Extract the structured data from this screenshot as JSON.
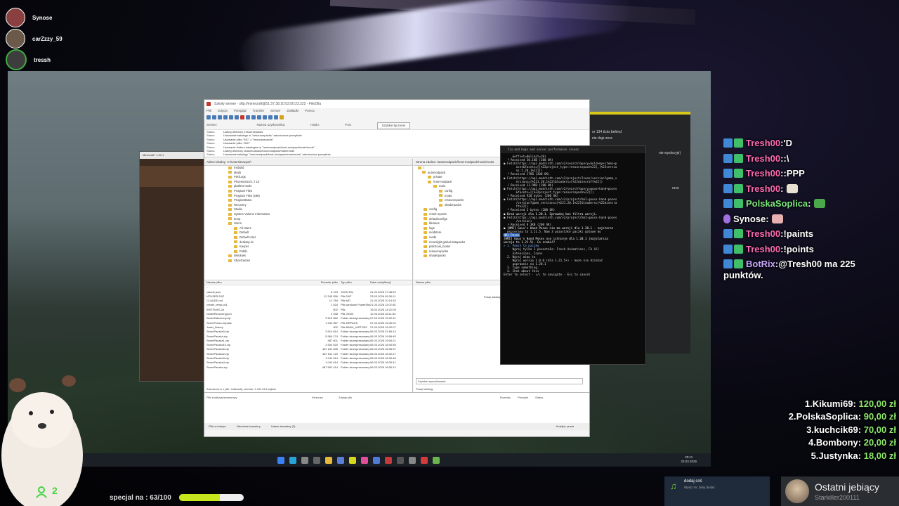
{
  "viewers": [
    "Synose",
    "carZzzy_59",
    "tressh"
  ],
  "minecraft": {
    "title": "Minecraft* 1.20.1"
  },
  "dark_panel": {
    "line1": "or 134 ticks behind",
    "line2": "nie daje zesc",
    "line3": "nie wyslocyje)",
    "line4": "urce"
  },
  "filezilla": {
    "title": "Szkoły serwer - sftp://minecraft@51.57.38.10:53:50:23.222 - FileZilla",
    "menu": [
      "Plik",
      "Edycja",
      "Przegląd",
      "Transfer",
      "Serwer",
      "Zakładki",
      "Pomoc"
    ],
    "quickconnect": {
      "server_label": "Serwer:",
      "user_label": "Nazwa użytkownika:",
      "pass_label": "Hasło:",
      "port_label": "Port:",
      "button": "Szybkie łączenie"
    },
    "log": [
      {
        "k": "Status:",
        "v": "Listing directory /resourcepacks"
      },
      {
        "k": "Status:",
        "v": "Listowanie katalogu w \"/resourcepacks\" zakończone pomyślnie"
      },
      {
        "k": "Status:",
        "v": "Usuwanie pliku \"MC\" z \"/resourcepacks\""
      },
      {
        "k": "Status:",
        "v": "Usuwanie pliku \"/MC\""
      },
      {
        "k": "Status:",
        "v": "Usuwanie folderu katalogów w \"/automodpack/host-modpack/main/mods\""
      },
      {
        "k": "Status:",
        "v": "Listing directory /automodpack/host-modpack/main/mods"
      },
      {
        "k": "Status:",
        "v": "Listowanie katalogu \"/automodpack/host-modpack/main/mods\" zakończone pomyślnie"
      }
    ],
    "local_addr": {
      "label": "Adres lokalny:",
      "value": "C:\\Users\\Kacper\\"
    },
    "remote_addr": {
      "label": "Strona zdalna:",
      "value": "/automodpack/host-modpack/main/mods"
    },
    "local_tree": [
      "msbuild",
      "Mods",
      "PerfLogs",
      "PhoenixSoul 1.7.10",
      "platform-tools",
      "Program Files",
      "Program Files (x86)",
      "ProgramData",
      "Recovery",
      "Studio",
      "System Volume Information",
      "temp",
      "Users",
      "All Users",
      "Default",
      "Default User",
      "desktop.ini",
      "Kacper",
      "Public",
      "Windows",
      "XboxGames"
    ],
    "remote_tree": [
      "/",
      "automodpack",
      "private",
      "host-modpack",
      "main",
      "config",
      "mods",
      "resourcepacks",
      "shaderpacks",
      "config",
      "crash-reports",
      "defaultconfigs",
      "libraries",
      "logs",
      "modstore",
      "mods",
      "moonlight-global-datapacks",
      "patchouli_books",
      "resourcepacks",
      "shaderpacks"
    ],
    "local_cols": [
      "Nazwa pliku",
      "Rozmiar pliku",
      "Typ pliku",
      "Data modyfikacji"
    ],
    "local_files": [
      {
        "name": "..",
        "size": "",
        "type": "",
        "date": ""
      },
      {
        "name": "claude.json",
        "size": "8 123",
        "type": "JSON File",
        "date": "21.02.2026 17:48:59"
      },
      {
        "name": "NTUSER.DAT",
        "size": "12 345 556",
        "type": "Plik DAT",
        "date": "23.03.2026 09:30:11"
      },
      {
        "name": "CLAUDE.md",
        "size": "12 784",
        "type": "Plik MD",
        "date": "21.03.2026 10:14:33"
      },
      {
        "name": "create_temp.ps1",
        "size": "1 024",
        "type": "Plik windows PowerShell",
        "date": "21.03.2026 11:02:45"
      },
      {
        "name": "INSTRUKCJA",
        "size": "502",
        "type": "Plik",
        "date": "15.03.2026 14:21:09"
      },
      {
        "name": "DeathRecovery.json",
        "size": "2 048",
        "type": "Plik JSON",
        "date": "12.03.2026 18:11:54"
      },
      {
        "name": "SemeZaloczony.zip",
        "size": "2 519 562",
        "type": "Folder skompresowany",
        "date": "07.03.2026 15:22:31"
      },
      {
        "name": "SemePoses.mrpack",
        "size": "1 234 567",
        "type": "Plik MRPACK",
        "date": "07.03.2026 15:40:02"
      },
      {
        "name": ".bash_history",
        "size": "302",
        "type": "Plik BASH_HISTORY",
        "date": "21.03.2026 16:32:07"
      },
      {
        "name": "SemePaczka0.zip",
        "size": "3 910 814",
        "type": "Folder skompresowany",
        "date": "06.03.2026 21:56:13"
      },
      {
        "name": "SemePaczka.zip",
        "size": "5 964 174",
        "type": "Folder skompresowany",
        "date": "06.03.2026 19:59:45"
      },
      {
        "name": "SemePaczka1.zip",
        "size": "487 601",
        "type": "Folder skompresowany",
        "date": "06.03.2026 19:04:21"
      },
      {
        "name": "SemePaczka10.zip",
        "size": "2 500 520",
        "type": "Folder skompresowany",
        "date": "06.03.2026 18:40:55"
      },
      {
        "name": "SemePaczka5.zip",
        "size": "487 611 695",
        "type": "Folder skompresowany",
        "date": "06.03.2026 18:36:37"
      },
      {
        "name": "SemePaczka2.zip",
        "size": "487 611 120",
        "type": "Folder skompresowany",
        "date": "06.03.2026 18:32:27"
      },
      {
        "name": "SemePaczka3.zip",
        "size": "1 044 014",
        "type": "Folder skompresowany",
        "date": "06.03.2026 18:30:48"
      },
      {
        "name": "SemePaczka4.zip",
        "size": "1 044 614",
        "type": "Folder skompresowany",
        "date": "06.03.2026 18:30:41"
      },
      {
        "name": "SemePaczka.zip",
        "size": "487 592 414",
        "type": "Folder skompresowany",
        "date": "06.03.2026 18:26:12"
      }
    ],
    "local_status": "Zaznaczono 1 plik. Całkowity rozmiar: 1 044 614 bajtów",
    "remote_cols": [
      "Nazwa pliku"
    ],
    "remote_empty": "Pusty katalog",
    "remote_status": "Pusty katalog.",
    "remote_filter": "Szybkie wyszukiwanie",
    "queue_cols": [
      "Plik źródłowy/serwerowy",
      "Kierunek",
      "Zdalny plik",
      "Rozmiar",
      "Priorytet",
      "Status"
    ],
    "queue_tabs": [
      "Pliki w kolejce",
      "Nieudane transfery",
      "Udane transfery (3)"
    ],
    "queue_status": "Kolejka: pusta"
  },
  "terminal": {
    "title": "Fix mod bugs and server performance issues",
    "lines": [
      "     &offset=0&limit=20)",
      "  └ Received 30.1KB (200 OK)",
      "",
      "● Fetch(https://api.modrinth.com/v2/search?query=hold+my+items+p",
      "       oses&facets=[[%22project_type:resourcepack%22],[%22versio",
      "       ns:1.20.1%22]])",
      "  └ Received 17KB (200 OK)",
      "",
      "● Fetch(https://api.modrinth.com/v2/project/Icons/version?game_v",
      "       ersions=[%221.20.1%22]&loaders=[%22minecraft%22])",
      "  └ Received 13.9KB (200 OK)",
      "",
      "● Fetch(https://api.modrinth.com/v2/search?query=gous+hand+poses",
      "       &facets=[[%22project_type:resourcepack%22]])",
      "  └ Received 920 bytes (200 OK)",
      "",
      "● Fetch(https://api.modrinth.com/v2/project/hmI-gouss-hand-poses",
      "       /version?game_versions=[%221.20.1%22]&loaders=[%22minecra",
      "       ft%22])",
      "  └ Received 2 bytes (200 OK)",
      "",
      "● Brak wersji dla 1.20.1. Sprawdzę bez filtra wersji.",
      "",
      "● Fetch(https://api.modrinth.com/v2/project/hmI-gouss-hand-poses",
      "       /version)",
      "  └ Received 8.3KB (200 OK)",
      "",
      "● [HMI] Gous's Hand Poses nie ma wersji dla 1.20.1 - najstarsz",
      "  wspierana to 1.21.5. Nam 3 pozostałe paczki gotowe do",
      "",
      "HMI Poses",
      "",
      "[HMI] Gous's Hand Poses nie istnieje dla 1.20.1 (najstarsza",
      "wersja to 1.21.5). Co zrobić?",
      "",
      "> 1. Pomiń tę paczkę",
      "     Wgraj tylko 3 pozostałe: Fresh Animations, FA All",
      "     Extensions, Icons",
      "  2. Wgraj mimo to",
      "     Wgraj wersję 1.0.0 (dla 1.21.5+) - może nie działać",
      "     poprawnie na 1.20.1",
      "  3. Type something.",
      "",
      "  4. Chat about this",
      "",
      "Enter to select · ↑/↓ to navigate · Esc to cancel"
    ]
  },
  "taskbar": {
    "time": "20:11",
    "date": "23.03.2026"
  },
  "chat": [
    {
      "user": "Tresh00",
      "msg": "'D"
    },
    {
      "user": "Tresh00",
      "msg": ":\\"
    },
    {
      "user": "Tresh00",
      "msg": ":PPP"
    },
    {
      "user": "Tresh00",
      "msg": ""
    },
    {
      "user": "PolskaSoplica",
      "msg": ""
    },
    {
      "user": "Synose",
      "msg": ""
    },
    {
      "user": "Tresh00",
      "msg": "!paints"
    },
    {
      "user": "Tresh00",
      "msg": "!points"
    },
    {
      "user": "BotRix",
      "msg": "@Tresh00 ma 225"
    }
  ],
  "chat_wrap": "punktów.",
  "leaderboard": [
    {
      "rank": "1.",
      "name": "Kikumi69:",
      "amount": "120,00 zł"
    },
    {
      "rank": "2.",
      "name": "PolskaSoplica:",
      "amount": "90,00 zł"
    },
    {
      "rank": "3.",
      "name": "kuchcik69:",
      "amount": "70,00 zł"
    },
    {
      "rank": "4.",
      "name": "Bombony:",
      "amount": "20,00 zł"
    },
    {
      "rank": "5.",
      "name": "Justynka:",
      "amount": "18,00 zł"
    }
  ],
  "special": {
    "label": "specjal na : 63/100",
    "progress": 0.63
  },
  "group_count": "2",
  "now_playing": {
    "title": "dodaj coś",
    "sub": "Wpisz !sr, żeby dodać"
  },
  "last_sub": {
    "title": "Ostatni jebiący",
    "user": "Starkiller200111"
  }
}
